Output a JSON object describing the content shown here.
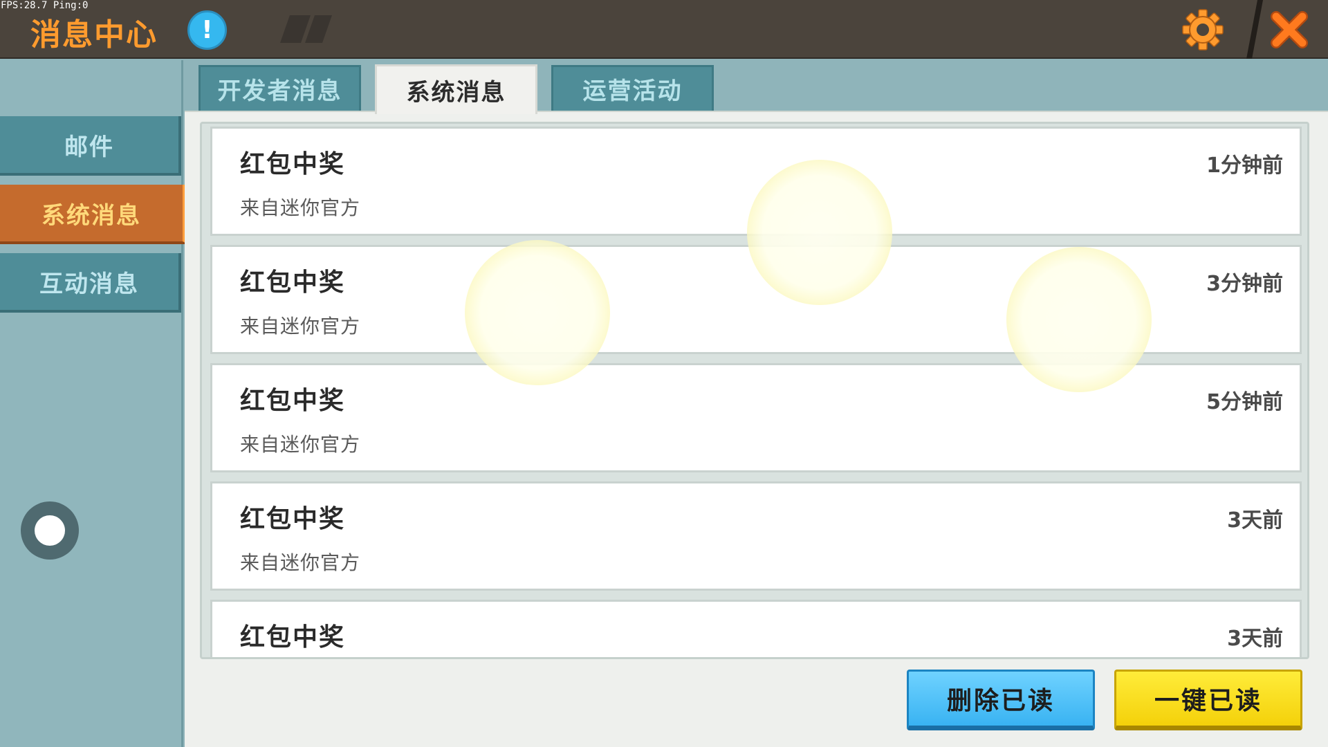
{
  "status": {
    "fps_text": "FPS:28.7  Ping:0"
  },
  "header": {
    "title": "消息中心",
    "info_glyph": "!"
  },
  "sidebar": {
    "items": [
      {
        "label": "邮件",
        "active": false
      },
      {
        "label": "系统消息",
        "active": true
      },
      {
        "label": "互动消息",
        "active": false
      }
    ]
  },
  "tabs": [
    {
      "label": "开发者消息",
      "active": false
    },
    {
      "label": "系统消息",
      "active": true
    },
    {
      "label": "运营活动",
      "active": false
    }
  ],
  "messages": [
    {
      "title": "红包中奖",
      "from": "来自迷你官方",
      "time": "1分钟前"
    },
    {
      "title": "红包中奖",
      "from": "来自迷你官方",
      "time": "3分钟前"
    },
    {
      "title": "红包中奖",
      "from": "来自迷你官方",
      "time": "5分钟前"
    },
    {
      "title": "红包中奖",
      "from": "来自迷你官方",
      "time": "3天前"
    },
    {
      "title": "红包中奖",
      "from": "",
      "time": "3天前"
    }
  ],
  "actions": {
    "delete_read": "删除已读",
    "mark_all_read": "一键已读"
  },
  "icons": {
    "info": "info-icon",
    "settings": "gear-icon",
    "close": "close-icon",
    "joystick": "joystick-icon"
  },
  "colors": {
    "topbar": "#4b443c",
    "title_orange": "#ff9b2e",
    "sidebar_active": "#c56b2d",
    "tab_teal": "#4f8d98",
    "button_blue": "#39b3f2",
    "button_yellow": "#f4d10a"
  }
}
